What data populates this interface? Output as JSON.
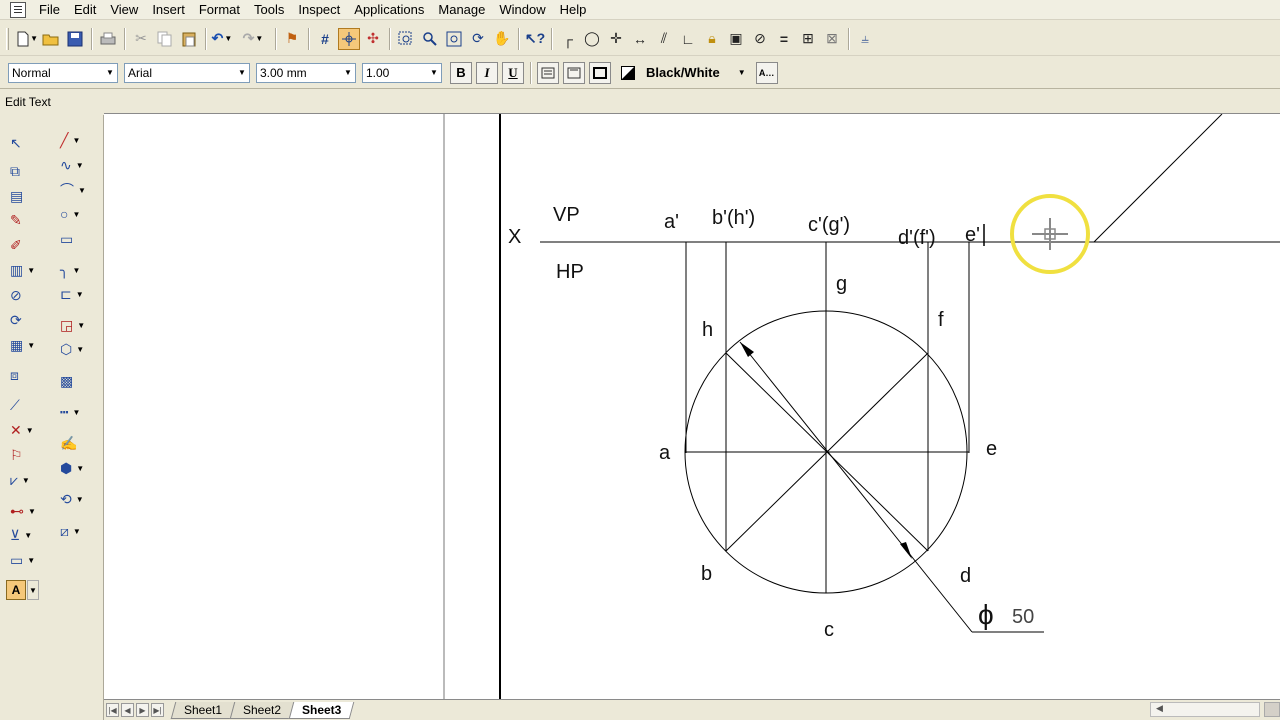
{
  "menu": {
    "items": [
      "File",
      "Edit",
      "View",
      "Insert",
      "Format",
      "Tools",
      "Inspect",
      "Applications",
      "Manage",
      "Window",
      "Help"
    ]
  },
  "format_bar": {
    "style_value": "Normal",
    "font_value": "Arial",
    "size_value": "3.00 mm",
    "spacing_value": "1.00",
    "bold_label": "B",
    "italic_label": "I",
    "underline_label": "U",
    "color_label": "Black/White"
  },
  "status": {
    "edit_text": "Edit Text"
  },
  "drawing": {
    "x_label": "X",
    "vp_label": "VP",
    "hp_label": "HP",
    "top_labels": [
      "a'",
      "b'(h')",
      "c'(g')",
      "d'(f')",
      "e'"
    ],
    "circle_labels": [
      "g",
      "h",
      "f",
      "a",
      "e",
      "b",
      "d",
      "c"
    ],
    "dimension_symbol": "ϕ",
    "dimension_value": "50"
  },
  "sheets": {
    "tabs": [
      "Sheet1",
      "Sheet2",
      "Sheet3"
    ],
    "active": "Sheet3"
  },
  "colors": {
    "highlight_ring": "#f0e040",
    "active_button": "#f5c87a"
  },
  "icons": {
    "toolbar": [
      "new-icon",
      "open-icon",
      "save-icon",
      "print-icon",
      "cut-icon",
      "copy-icon",
      "paste-icon",
      "undo-icon",
      "redo-icon",
      "flag-icon",
      "grid-icon",
      "snap-icon",
      "smartsnap-icon",
      "zoom-window-icon",
      "zoom-icon",
      "zoom-fit-icon",
      "rotate-view-icon",
      "pan-icon",
      "whats-this-icon",
      "perpendicular-icon",
      "circle-icon",
      "cross-icon",
      "distance-icon",
      "parallel-icon",
      "angle-icon",
      "lock-icon",
      "image-icon",
      "tangent-icon",
      "equal-icon",
      "symmetric-icon",
      "mirror-icon",
      "constraint-icon"
    ]
  }
}
